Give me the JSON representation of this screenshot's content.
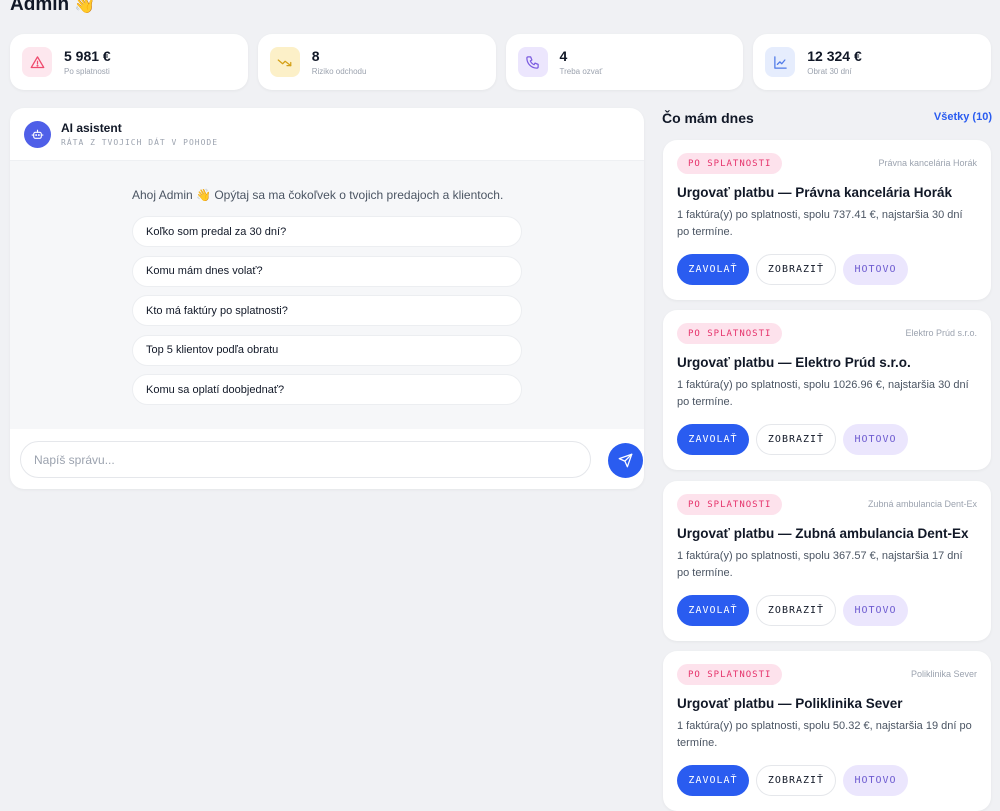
{
  "header": {
    "title": "Admin",
    "emoji": "👋"
  },
  "stats": [
    {
      "value": "5 981 €",
      "label": "Po splatnosti",
      "icon": "alert-triangle-icon",
      "color": "#ef4a6d",
      "bg": "#fde7ee"
    },
    {
      "value": "8",
      "label": "Riziko odchodu",
      "icon": "trending-down-icon",
      "color": "#d4a017",
      "bg": "#fcf0c8"
    },
    {
      "value": "4",
      "label": "Treba ozvať",
      "icon": "phone-icon",
      "color": "#7c5ce0",
      "bg": "#ece6fd"
    },
    {
      "value": "12 324 €",
      "label": "Obrat 30 dní",
      "icon": "line-chart-icon",
      "color": "#4f7ae8",
      "bg": "#e6edfd"
    }
  ],
  "assistant": {
    "title": "AI asistent",
    "subtitle": "RÁTA Z TVOJICH DÁT V POHODE",
    "greeting": "Ahoj Admin 👋  Opýtaj sa ma čokoľvek o tvojich predajoch a klientoch.",
    "suggestions": [
      "Koľko som predal za 30 dní?",
      "Komu mám dnes volať?",
      "Kto má faktúry po splatnosti?",
      "Top 5 klientov podľa obratu",
      "Komu sa oplatí doobjednať?"
    ],
    "input_placeholder": "Napíš správu..."
  },
  "today": {
    "title": "Čo mám dnes",
    "see_all": "Všetky (10)",
    "tasks": [
      {
        "badge": "PO SPLATNOSTI",
        "client": "Právna kancelária Horák",
        "title": "Urgovať platbu — Právna kancelária Horák",
        "desc": "1 faktúra(y) po splatnosti, spolu 737.41 €, najstaršia 30 dní po termíne.",
        "call": "ZAVOLAŤ",
        "view": "ZOBRAZIŤ",
        "done": "HOTOVO"
      },
      {
        "badge": "PO SPLATNOSTI",
        "client": "Elektro Prúd s.r.o.",
        "title": "Urgovať platbu — Elektro Prúd s.r.o.",
        "desc": "1 faktúra(y) po splatnosti, spolu 1026.96 €, najstaršia 30 dní po termíne.",
        "call": "ZAVOLAŤ",
        "view": "ZOBRAZIŤ",
        "done": "HOTOVO"
      },
      {
        "badge": "PO SPLATNOSTI",
        "client": "Zubná ambulancia Dent-Ex",
        "title": "Urgovať platbu — Zubná ambulancia Dent-Ex",
        "desc": "1 faktúra(y) po splatnosti, spolu 367.57 €, najstaršia 17 dní po termíne.",
        "call": "ZAVOLAŤ",
        "view": "ZOBRAZIŤ",
        "done": "HOTOVO"
      },
      {
        "badge": "PO SPLATNOSTI",
        "client": "Poliklinika Sever",
        "title": "Urgovať platbu — Poliklinika Sever",
        "desc": "1 faktúra(y) po splatnosti, spolu 50.32 €, najstaršia 19 dní po termíne.",
        "call": "ZAVOLAŤ",
        "view": "ZOBRAZIŤ",
        "done": "HOTOVO"
      }
    ]
  }
}
